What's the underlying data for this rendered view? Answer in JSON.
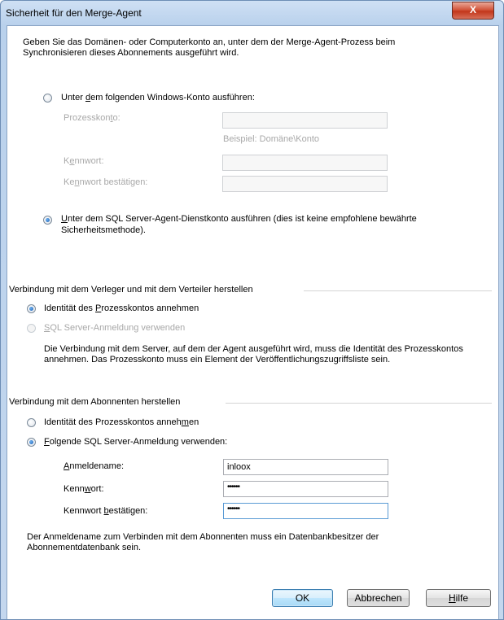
{
  "window": {
    "title": "Sicherheit für den Merge-Agent",
    "close_label": "X"
  },
  "intro": "Geben Sie das Domänen- oder Computerkonto an, unter dem der Merge-Agent-Prozess beim Synchronisieren dieses Abonnements ausgeführt wird.",
  "account": {
    "windows_option": {
      "pre": "Unter ",
      "key": "d",
      "post": "em folgenden Windows-Konto ausführen:",
      "selected": false
    },
    "process_account_label": {
      "pre": "Prozesskon",
      "key": "t",
      "post": "o:"
    },
    "process_account_value": "",
    "example": "Beispiel: Domäne\\Konto",
    "password_label": {
      "pre": "K",
      "key": "e",
      "post": "nnwort:"
    },
    "password_value": "",
    "confirm_label": {
      "pre": "Ke",
      "key": "n",
      "post": "nwort bestätigen:"
    },
    "confirm_value": "",
    "sql_agent_option": {
      "key": "U",
      "post": "nter dem SQL Server-Agent-Dienstkonto ausführen (dies ist keine empfohlene bewährte",
      "line2": "Sicherheitsmethode).",
      "selected": true
    }
  },
  "publisher": {
    "group_title": "Verbindung mit dem Verleger und mit dem Verteiler herstellen",
    "impersonate": {
      "pre": "Identität des ",
      "key": "P",
      "post": "rozesskontos annehmen",
      "selected": true
    },
    "sql_login": {
      "key": "S",
      "post": "QL Server-Anmeldung verwenden",
      "selected": false,
      "enabled": false
    },
    "note": "Die Verbindung mit dem Server, auf dem der Agent ausgeführt wird, muss die Identität des Prozesskontos annehmen. Das Prozesskonto muss ein Element der Veröffentlichungszugriffsliste sein."
  },
  "subscriber": {
    "group_title": "Verbindung mit dem Abonnenten herstellen",
    "impersonate": {
      "pre": "Identität des Prozesskontos anneh",
      "key": "m",
      "post": "en",
      "selected": false
    },
    "sql_login": {
      "key": "F",
      "post": "olgende SQL Server-Anmeldung verwenden:",
      "selected": true
    },
    "login_label": {
      "key": "A",
      "post": "nmeldename:"
    },
    "login_value": "inloox",
    "password_label": {
      "pre": "Kenn",
      "key": "w",
      "post": "ort:"
    },
    "password_value": "••••••",
    "confirm_label": {
      "pre": "Kennwort ",
      "key": "b",
      "post": "estätigen:"
    },
    "confirm_value": "••••••",
    "note": "Der Anmeldename zum Verbinden mit dem Abonnenten muss ein Datenbankbesitzer der Abonnementdatenbank sein."
  },
  "buttons": {
    "ok": "OK",
    "cancel": "Abbrechen",
    "help": {
      "key": "H",
      "post": "ilfe"
    }
  }
}
